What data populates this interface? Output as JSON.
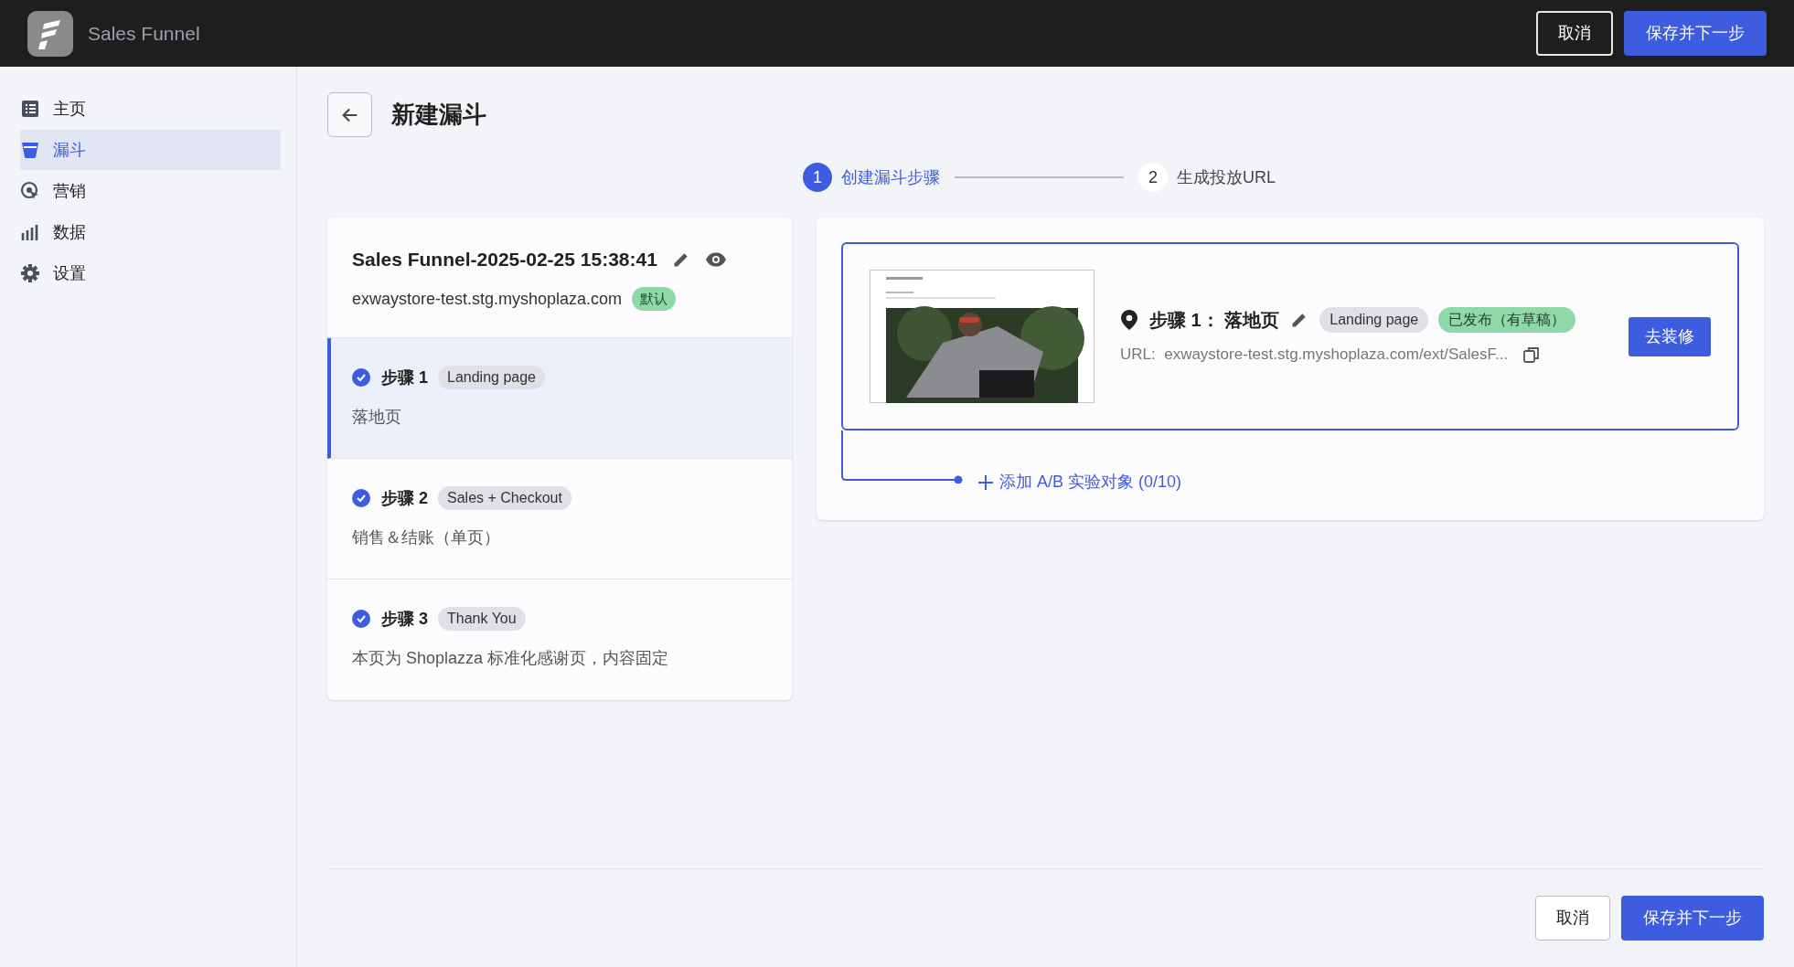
{
  "app": {
    "title": "Sales Funnel",
    "actions": [
      {
        "label": "取消",
        "kind": "secondary"
      },
      {
        "label": "保存并下一步",
        "kind": "primary"
      }
    ]
  },
  "sidebar": {
    "items": [
      {
        "label": "主页",
        "selected": false
      },
      {
        "label": "漏斗",
        "selected": true
      },
      {
        "label": "营销",
        "selected": false
      },
      {
        "label": "数据",
        "selected": false
      },
      {
        "label": "设置",
        "selected": false
      }
    ]
  },
  "page": {
    "title": "新建漏斗"
  },
  "stepper": [
    {
      "number": "1",
      "label": "创建漏斗步骤",
      "selected": true
    },
    {
      "number": "2",
      "label": "生成投放URL",
      "selected": false
    }
  ],
  "funnel": {
    "name": "Sales Funnel-2025-02-25 15:38:41",
    "domain": "exwaystore-test.stg.myshoplaza.com",
    "domain_badge": "默认",
    "steps": [
      {
        "title": "步骤 1",
        "tag": "Landing page",
        "description": "落地页",
        "checked": true,
        "selected": true
      },
      {
        "title": "步骤 2",
        "tag": "Sales + Checkout",
        "description": "销售＆结账（单页）",
        "checked": true,
        "selected": false
      },
      {
        "title": "步骤 3",
        "tag": "Thank You",
        "description": "本页为 Shoplazza 标准化感谢页，内容固定",
        "checked": true,
        "selected": false
      }
    ]
  },
  "detail": {
    "title": "步骤 1： 落地页",
    "tag": "Landing page",
    "status": "已发布（有草稿）",
    "url": "URL:  exwaystore-test.stg.myshoplaza.com/ext/SalesF...",
    "action": "去装修",
    "add_variant": "添加 A/B 实验对象 (0/10)"
  },
  "footer": {
    "actions": [
      {
        "label": "取消",
        "kind": "secondary"
      },
      {
        "label": "保存并下一步",
        "kind": "primary"
      }
    ]
  }
}
